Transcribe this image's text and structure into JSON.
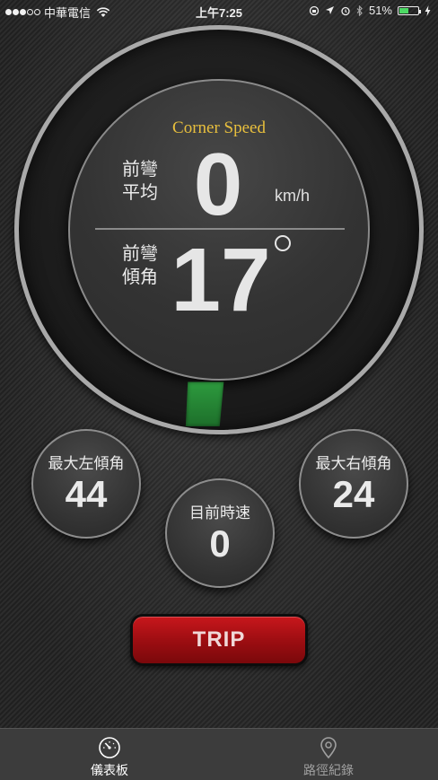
{
  "status_bar": {
    "carrier": "中華電信",
    "time": "上午7:25",
    "battery_percent": "51%",
    "battery_level": 0.51,
    "signal_bars": 3,
    "signal_total": 5
  },
  "gauge": {
    "title": "Corner Speed",
    "avg_label_line1": "前彎",
    "avg_label_line2": "平均",
    "speed_value": "0",
    "speed_unit": "km/h",
    "tilt_label_line1": "前彎",
    "tilt_label_line2": "傾角",
    "tilt_value": "17",
    "marker_color": "#2d9a3e"
  },
  "dials": {
    "max_left": {
      "label": "最大左傾角",
      "value": "44"
    },
    "max_right": {
      "label": "最大右傾角",
      "value": "24"
    },
    "current_speed": {
      "label": "目前時速",
      "value": "0"
    }
  },
  "trip_button": {
    "label": "TRIP"
  },
  "tab_bar": {
    "tabs": [
      {
        "label": "儀表板",
        "icon": "gauge-icon",
        "active": true
      },
      {
        "label": "路徑紀錄",
        "icon": "map-pin-icon",
        "active": false
      }
    ]
  },
  "colors": {
    "accent_gold": "#e8bf3d",
    "trip_red": "#b01418",
    "battery_green": "#4cd964"
  }
}
